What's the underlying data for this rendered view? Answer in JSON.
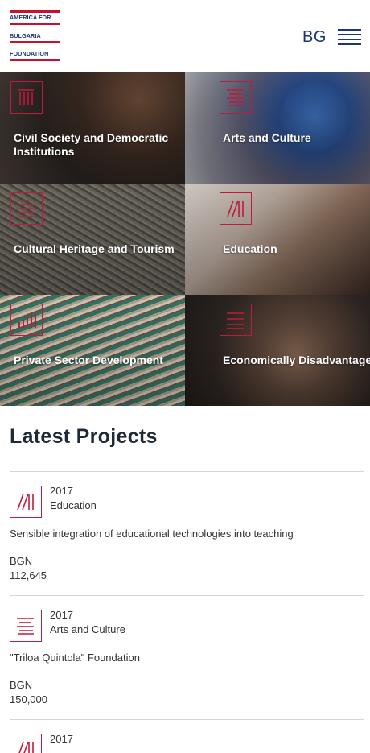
{
  "header": {
    "logo": {
      "line1": "AMERICA FOR",
      "line2": "BULGARIA",
      "line3": "FOUNDATION"
    },
    "language": "BG",
    "menu_icon": "hamburger-menu-icon"
  },
  "categories": [
    {
      "label": "Civil Society and Democratic Institutions",
      "icon": "columns-icon"
    },
    {
      "label": "Arts and Culture",
      "icon": "brush-strokes-icon"
    },
    {
      "label": "Cultural Heritage and Tourism",
      "icon": "heritage-icon"
    },
    {
      "label": "Education",
      "icon": "books-icon"
    },
    {
      "label": "Private Sector Development",
      "icon": "bar-chart-icon"
    },
    {
      "label": "Economically Disadvantaged",
      "icon": "layers-icon"
    }
  ],
  "latest": {
    "title": "Latest Projects",
    "projects": [
      {
        "year": "2017",
        "category": "Education",
        "title": "Sensible integration of educational technologies into teaching",
        "currency": "BGN",
        "amount": "112,645"
      },
      {
        "year": "2017",
        "category": "Arts and Culture",
        "title": "\"Triloa Quintola\" Foundation",
        "currency": "BGN",
        "amount": "150,000"
      },
      {
        "year": "2017"
      }
    ]
  },
  "colors": {
    "brand_blue": "#1d3576",
    "brand_red": "#c01a3c"
  }
}
